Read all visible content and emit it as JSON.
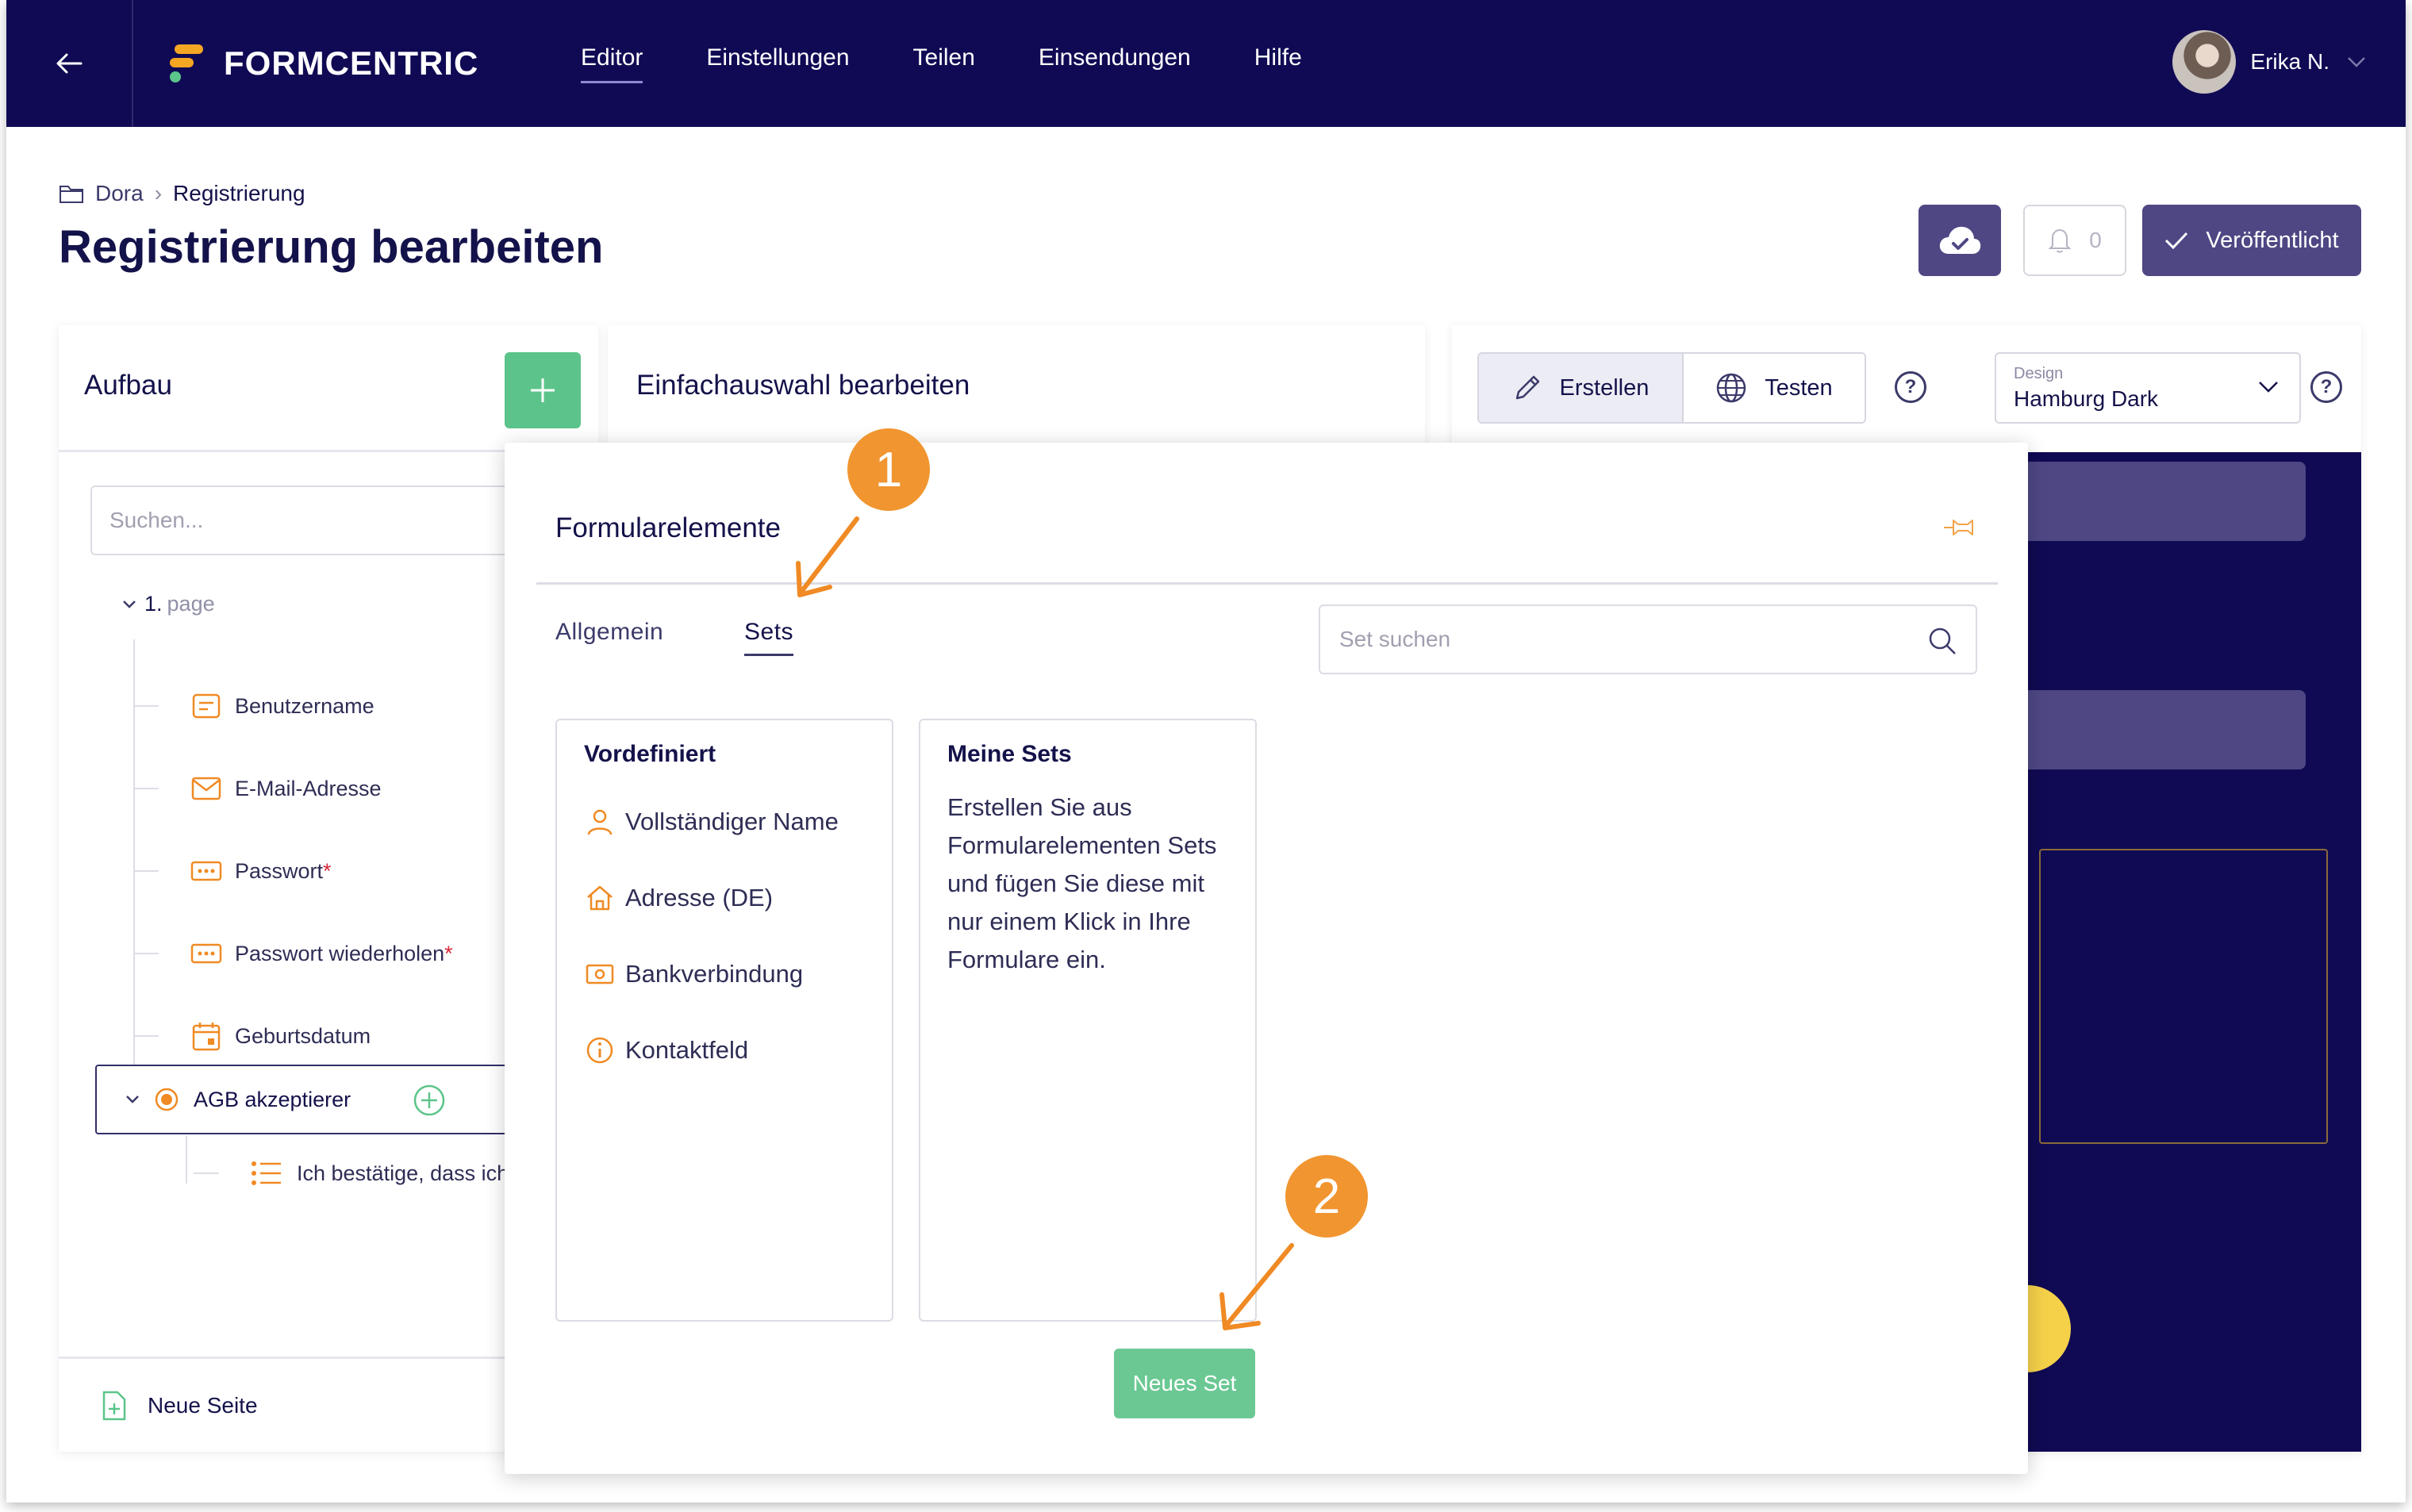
{
  "app": {
    "brand": "FORMCENTRIC",
    "nav": [
      {
        "label": "Editor",
        "active": true
      },
      {
        "label": "Einstellungen",
        "active": false
      },
      {
        "label": "Teilen",
        "active": false
      },
      {
        "label": "Einsendungen",
        "active": false
      },
      {
        "label": "Hilfe",
        "active": false
      }
    ],
    "user_name": "Erika N."
  },
  "breadcrumb": {
    "parent": "Dora",
    "current": "Registrierung"
  },
  "page_title": "Registrierung bearbeiten",
  "header_actions": {
    "notification_count": "0",
    "published_label": "Veröffentlicht"
  },
  "structure_panel": {
    "title": "Aufbau",
    "search_placeholder": "Suchen...",
    "page_number": "1.",
    "page_label": "page",
    "items": [
      {
        "label": "Benutzername",
        "required": "",
        "icon": "text-field-icon"
      },
      {
        "label": "E-Mail-Adresse",
        "required": "",
        "icon": "mail-icon"
      },
      {
        "label": "Passwort",
        "required": "*",
        "icon": "password-icon"
      },
      {
        "label": "Passwort wiederholen",
        "required": "*",
        "icon": "password-icon"
      },
      {
        "label": "Geburtsdatum",
        "required": "",
        "icon": "calendar-icon"
      }
    ],
    "selected_item": "AGB akzeptierer",
    "child_item": "Ich bestätige, dass ich",
    "new_page_label": "Neue Seite"
  },
  "edit_panel": {
    "title": "Einfachauswahl bearbeiten"
  },
  "preview_panel": {
    "tabs": [
      {
        "label": "Erstellen",
        "active": true
      },
      {
        "label": "Testen",
        "active": false
      }
    ],
    "design_label": "Design",
    "design_value": "Hamburg Dark",
    "help_glyph": "?"
  },
  "popover": {
    "title": "Formularelemente",
    "tabs": [
      {
        "label": "Allgemein",
        "active": false
      },
      {
        "label": "Sets",
        "active": true
      }
    ],
    "search_placeholder": "Set suchen",
    "predefined": {
      "title": "Vordefiniert",
      "items": [
        "Vollständiger Name",
        "Adresse (DE)",
        "Bankverbindung",
        "Kontaktfeld"
      ]
    },
    "my_sets": {
      "title": "Meine Sets",
      "description": "Erstellen Sie aus Formularelementen Sets und fügen Sie diese mit nur einem Klick in Ihre Formulare ein."
    },
    "new_set_label": "Neues Set"
  },
  "annotations": [
    "1",
    "2"
  ],
  "colors": {
    "navy": "#100a54",
    "purple": "#4e4784",
    "green": "#5cc48a",
    "orange": "#f19530",
    "icon_orange": "#f08a24"
  }
}
